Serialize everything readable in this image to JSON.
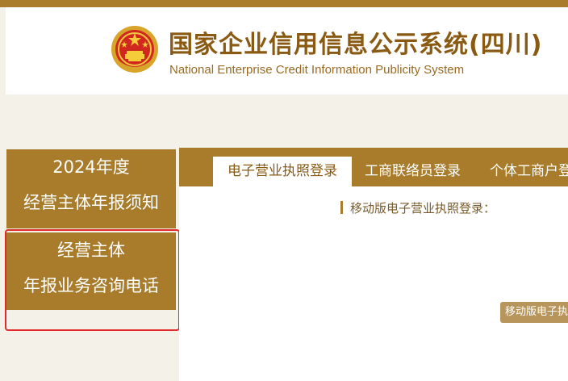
{
  "header": {
    "title_cn": "国家企业信用信息公示系统(四川)",
    "title_en": "National Enterprise Credit Information Publicity System",
    "emblem_icon": "national-emblem-icon"
  },
  "sidebar": {
    "cards": [
      {
        "line1": "2024年度",
        "line2": "经营主体年报须知"
      },
      {
        "line1": "经营主体",
        "line2": "年报业务咨询电话"
      }
    ]
  },
  "main": {
    "tabs": [
      {
        "label": "电子营业执照登录",
        "active": true
      },
      {
        "label": "工商联络员登录",
        "active": false
      },
      {
        "label": "个体工商户登",
        "active": false
      }
    ],
    "section_title": "移动版电子营业执照登录：",
    "mobile_button_label": "移动版电子执"
  },
  "colors": {
    "brand": "#a87c2b",
    "title_text": "#8a5a12",
    "highlight_box": "#e12a2a"
  }
}
